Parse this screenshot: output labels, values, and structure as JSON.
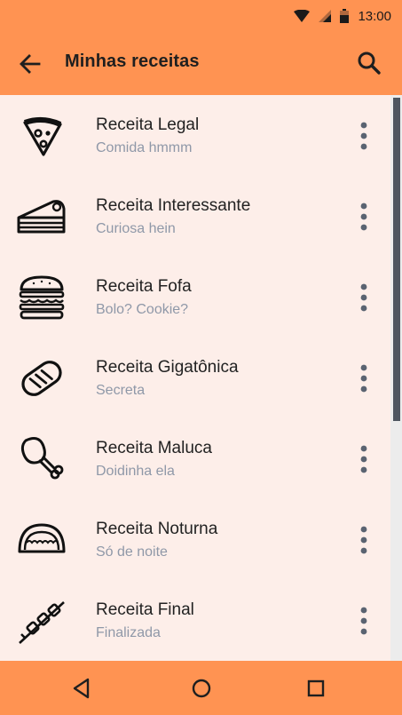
{
  "status": {
    "time": "13:00",
    "icons": [
      "wifi-icon",
      "signal-icon",
      "battery-icon"
    ]
  },
  "app_bar": {
    "title": "Minhas receitas",
    "back_icon": "arrow-back-icon",
    "search_icon": "search-icon"
  },
  "items": [
    {
      "title": "Receita Legal",
      "subtitle": "Comida hmmm",
      "icon": "pizza-slice-icon"
    },
    {
      "title": "Receita Interessante",
      "subtitle": "Curiosa hein",
      "icon": "cake-slice-icon"
    },
    {
      "title": "Receita Fofa",
      "subtitle": "Bolo? Cookie?",
      "icon": "burger-icon"
    },
    {
      "title": "Receita Gigatônica",
      "subtitle": "Secreta",
      "icon": "bread-icon"
    },
    {
      "title": "Receita Maluca",
      "subtitle": "Doidinha ela",
      "icon": "drumstick-icon"
    },
    {
      "title": "Receita Noturna",
      "subtitle": "Só de noite",
      "icon": "taco-icon"
    },
    {
      "title": "Receita Final",
      "subtitle": "Finalizada",
      "icon": "skewer-icon"
    }
  ],
  "nav": {
    "back": "nav-back-icon",
    "home": "nav-home-icon",
    "recents": "nav-recents-icon"
  },
  "colors": {
    "accent": "#ff9352",
    "background": "#fdeee9",
    "subtitle": "#8f98a8",
    "scrollbar": "#4d5560"
  }
}
